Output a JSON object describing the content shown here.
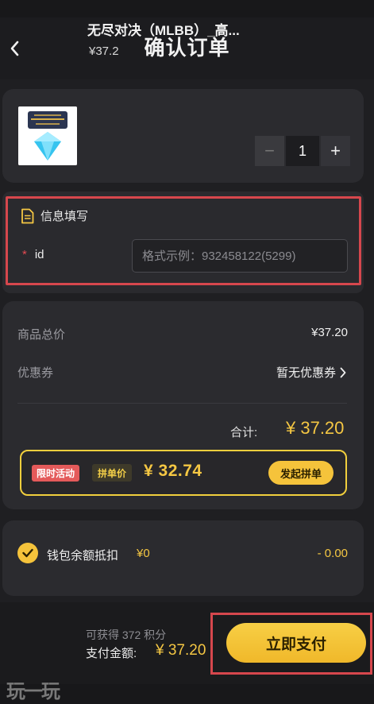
{
  "header": {
    "title": "确认订单",
    "back_icon": "chevron-left-icon"
  },
  "product": {
    "name": "无尽对决（MLBB）_高...",
    "price": "¥37.2",
    "quantity": "1",
    "minus_label": "−",
    "plus_label": "+"
  },
  "info": {
    "section_title": "信息填写",
    "required_mark": "*",
    "id_label": "id",
    "id_placeholder": "格式示例：932458122(5299)",
    "id_value": ""
  },
  "summary": {
    "goods_total_label": "商品总价",
    "goods_total_value": "¥37.20",
    "coupon_label": "优惠券",
    "coupon_value": "暂无优惠券",
    "total_label": "合计:",
    "total_value": "¥ 37.20",
    "group": {
      "badge_activity": "限时活动",
      "badge_group_price": "拼单价",
      "price": "¥ 32.74",
      "button": "发起拼单"
    }
  },
  "wallet": {
    "label": "钱包余额抵扣",
    "amount": "¥0",
    "deduction": "- 0.00",
    "checked": true
  },
  "bottom": {
    "points": "可获得 372 积分",
    "pay_label": "支付金额:",
    "pay_value": "¥ 37.20",
    "pay_button": "立即支付"
  },
  "watermark": "玩一玩",
  "colors": {
    "accent": "#f5c743",
    "highlight_outline": "#d6474d",
    "background": "#1f1f22",
    "card": "#2b2b2f"
  }
}
